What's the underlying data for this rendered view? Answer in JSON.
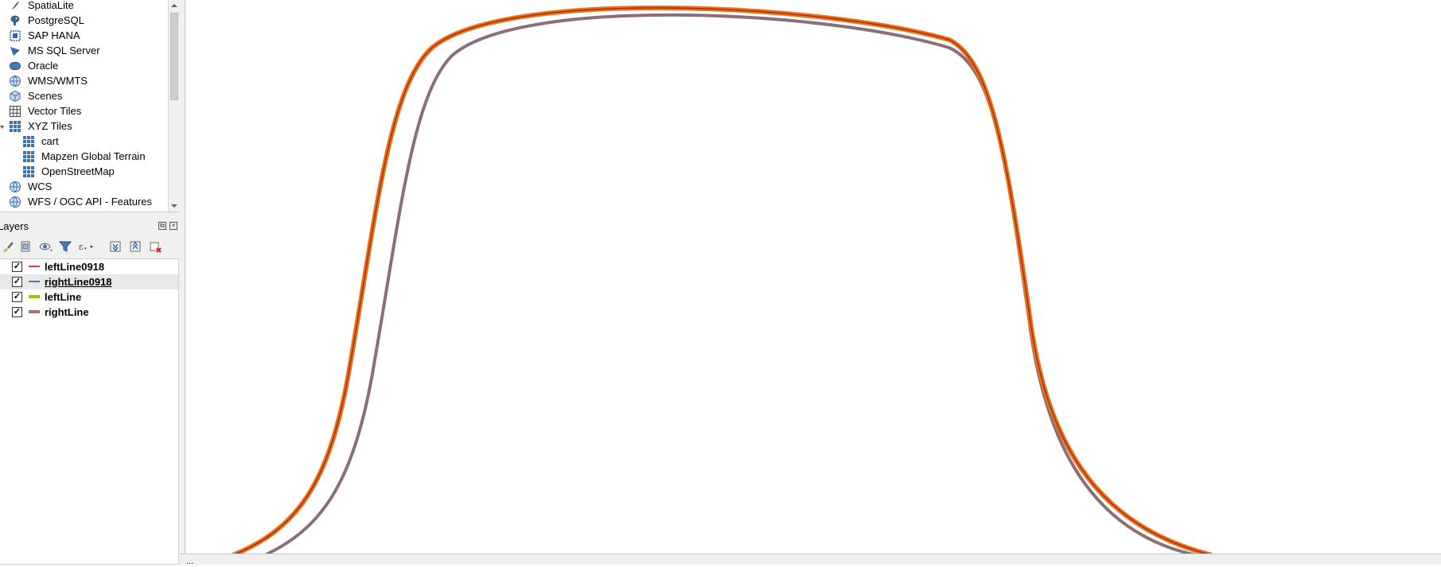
{
  "browser": {
    "items": [
      {
        "label": "SpatiaLite",
        "icon": "feather-icon"
      },
      {
        "label": "PostgreSQL",
        "icon": "elephant-icon"
      },
      {
        "label": "SAP HANA",
        "icon": "hana-icon"
      },
      {
        "label": "MS SQL Server",
        "icon": "mssql-icon"
      },
      {
        "label": "Oracle",
        "icon": "oracle-icon"
      },
      {
        "label": "WMS/WMTS",
        "icon": "globe-icon"
      },
      {
        "label": "Scenes",
        "icon": "cube-icon"
      },
      {
        "label": "Vector Tiles",
        "icon": "grid-icon"
      },
      {
        "label": "XYZ Tiles",
        "icon": "tiles-icon"
      },
      {
        "label": "cart",
        "icon": "tiles-icon"
      },
      {
        "label": "Mapzen Global Terrain",
        "icon": "tiles-icon"
      },
      {
        "label": "OpenStreetMap",
        "icon": "tiles-icon"
      },
      {
        "label": "WCS",
        "icon": "globe-icon"
      },
      {
        "label": "WFS / OGC API - Features",
        "icon": "globe-icon"
      }
    ]
  },
  "layers_panel": {
    "title": "Layers",
    "layers": [
      {
        "name": "leftLine0918",
        "checked": "✓",
        "color": "#e03a3a",
        "selected": false
      },
      {
        "name": "rightLine0918",
        "checked": "✓",
        "color": "#4a78b8",
        "selected": true
      },
      {
        "name": "leftLine",
        "checked": "✓",
        "color": "#b5b800",
        "selected": false
      },
      {
        "name": "rightLine",
        "checked": "✓",
        "color": "#a07868",
        "selected": false
      }
    ]
  },
  "status": {
    "text": "..."
  },
  "colors": {
    "line_orange": "#e07818",
    "line_red": "#c0201a",
    "line_gray": "#8a6e78"
  }
}
